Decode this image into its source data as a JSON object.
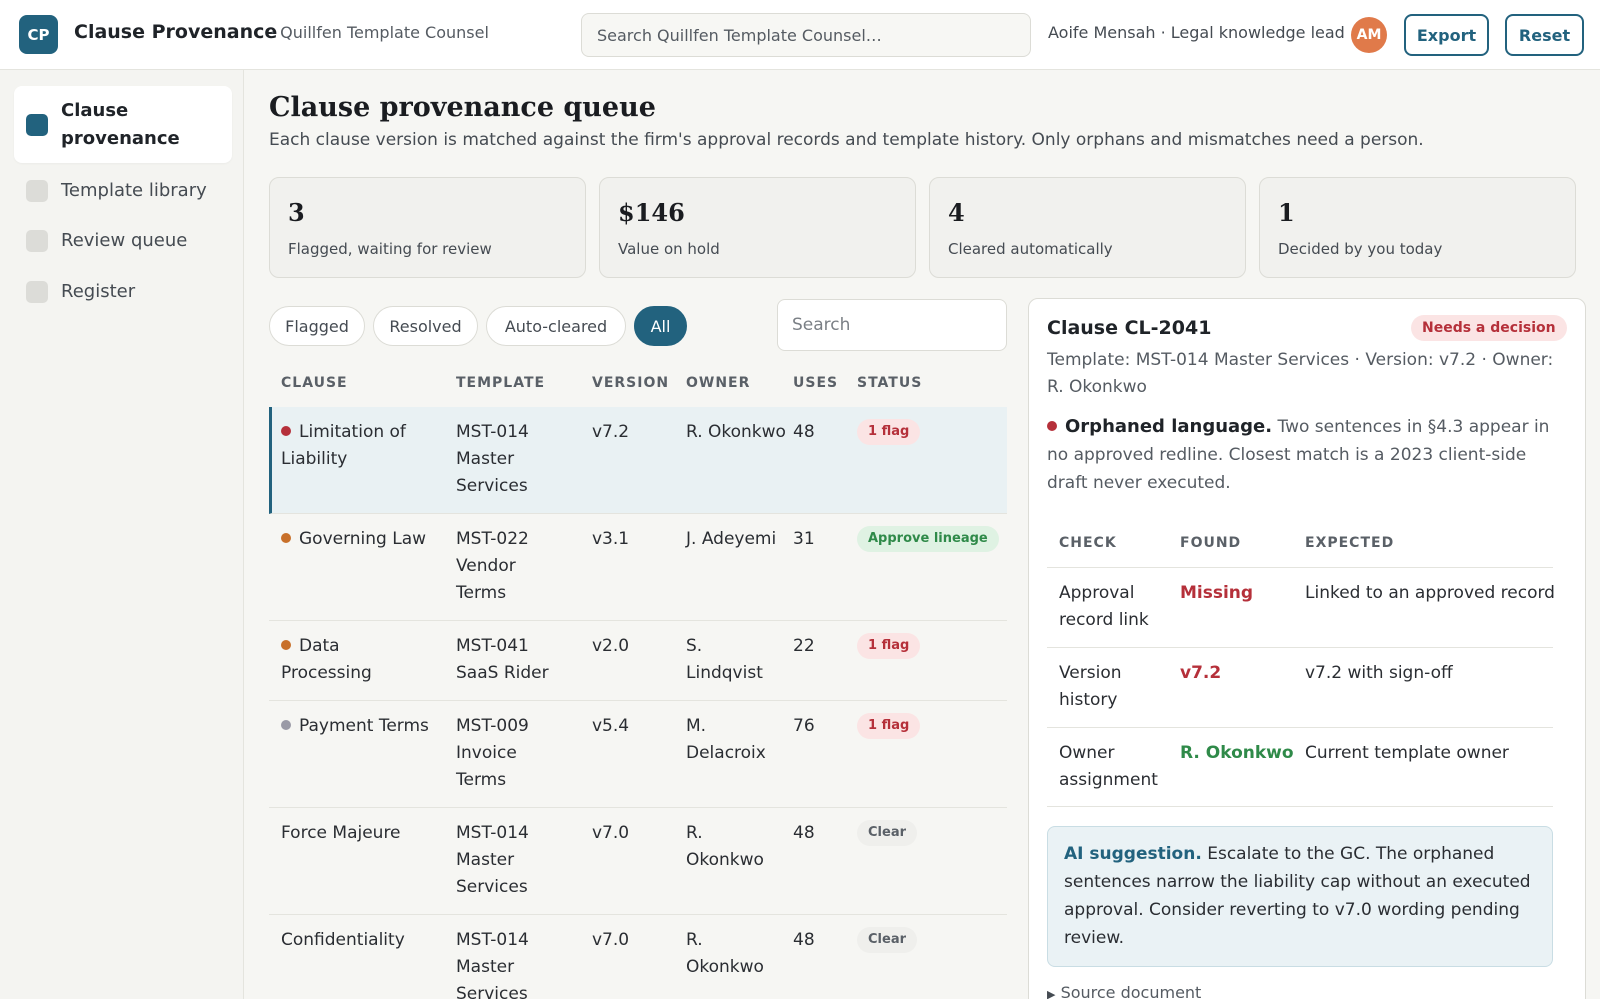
{
  "header": {
    "logo": "CP",
    "app_name": "Clause Provenance",
    "workspace": "· Quillfen Template Counsel",
    "search_placeholder": "Search Quillfen Template Counsel…",
    "user": "Aoife Mensah · Legal knowledge lead",
    "avatar": "AM",
    "export_label": "Export",
    "reset_label": "Reset"
  },
  "sidebar": {
    "items": [
      {
        "label": "Clause provenance",
        "active": true
      },
      {
        "label": "Template library"
      },
      {
        "label": "Review queue"
      },
      {
        "label": "Register"
      }
    ]
  },
  "page": {
    "title": "Clause provenance queue",
    "subtitle": "Each clause version is matched against the firm's approval records and template history. Only orphans and mismatches need a person."
  },
  "stats": [
    {
      "value": "3",
      "label": "Flagged, waiting for review"
    },
    {
      "value": "$146",
      "label": "Value on hold"
    },
    {
      "value": "4",
      "label": "Cleared automatically"
    },
    {
      "value": "1",
      "label": "Decided by you today"
    }
  ],
  "filters": [
    "Flagged",
    "Resolved",
    "Auto-cleared",
    "All"
  ],
  "active_filter": "All",
  "table_search_placeholder": "Search",
  "table": {
    "headers": [
      "CLAUSE",
      "TEMPLATE",
      "VERSION",
      "OWNER",
      "USES",
      "STATUS"
    ],
    "rows": [
      {
        "clause": "Limitation of Liability",
        "template": "MST-014 Master Services",
        "version": "v7.2",
        "owner": "R. Okonkwo",
        "uses": "48",
        "status": "1 flag",
        "dot": "#b5303a"
      },
      {
        "clause": "Governing Law",
        "template": "MST-022 Vendor Terms",
        "version": "v3.1",
        "owner": "J. Adeyemi",
        "uses": "31",
        "status": "Approve lineage",
        "dot": "#c8702a"
      },
      {
        "clause": "Data Processing",
        "template": "MST-041 SaaS Rider",
        "version": "v2.0",
        "owner": "S. Lindqvist",
        "uses": "22",
        "status": "1 flag",
        "dot": "#c8702a"
      },
      {
        "clause": "Payment Terms",
        "template": "MST-009 Invoice Terms",
        "version": "v5.4",
        "owner": "M. Delacroix",
        "uses": "76",
        "status": "1 flag",
        "dot": "#9a9aa6"
      },
      {
        "clause": "Force Majeure",
        "template": "MST-014 Master Services",
        "version": "v7.0",
        "owner": "R. Okonkwo",
        "uses": "48",
        "status": "Clear",
        "dot": null
      },
      {
        "clause": "Confidentiality",
        "template": "MST-014 Master Services",
        "version": "v7.0",
        "owner": "R. Okonkwo",
        "uses": "48",
        "status": "Clear",
        "dot": null
      }
    ]
  },
  "detail": {
    "title": "Clause CL-2041",
    "badge": "Needs a decision",
    "meta": "Template: MST-014 Master Services · Version: v7.2 · Owner: R. Okonkwo",
    "finding_title": "Orphaned language.",
    "finding_text": "Two sentences in §4.3 appear in no approved redline. Closest match is a 2023 client-side draft never executed.",
    "check_headers": [
      "CHECK",
      "FOUND",
      "EXPECTED"
    ],
    "checks": [
      {
        "check": "Approval record link",
        "found": "Missing",
        "expected": "Linked to an approved record"
      },
      {
        "check": "Version history",
        "found": "v7.2",
        "expected": "v7.2 with sign-off"
      },
      {
        "check": "Owner assignment",
        "found": "R. Okonkwo",
        "expected": "Current template owner"
      }
    ],
    "ai_title": "AI suggestion.",
    "ai_text": "Escalate to the GC. The orphaned sentences narrow the liability cap without an executed approval. Consider reverting to v7.0 wording pending review.",
    "source_label": "Source document",
    "source_icon": "triangle-right-icon"
  },
  "colors": {
    "accent": "#22627e",
    "flag": "#b5303a",
    "ok": "#2f8a49",
    "avatar": "#e07a4a"
  }
}
